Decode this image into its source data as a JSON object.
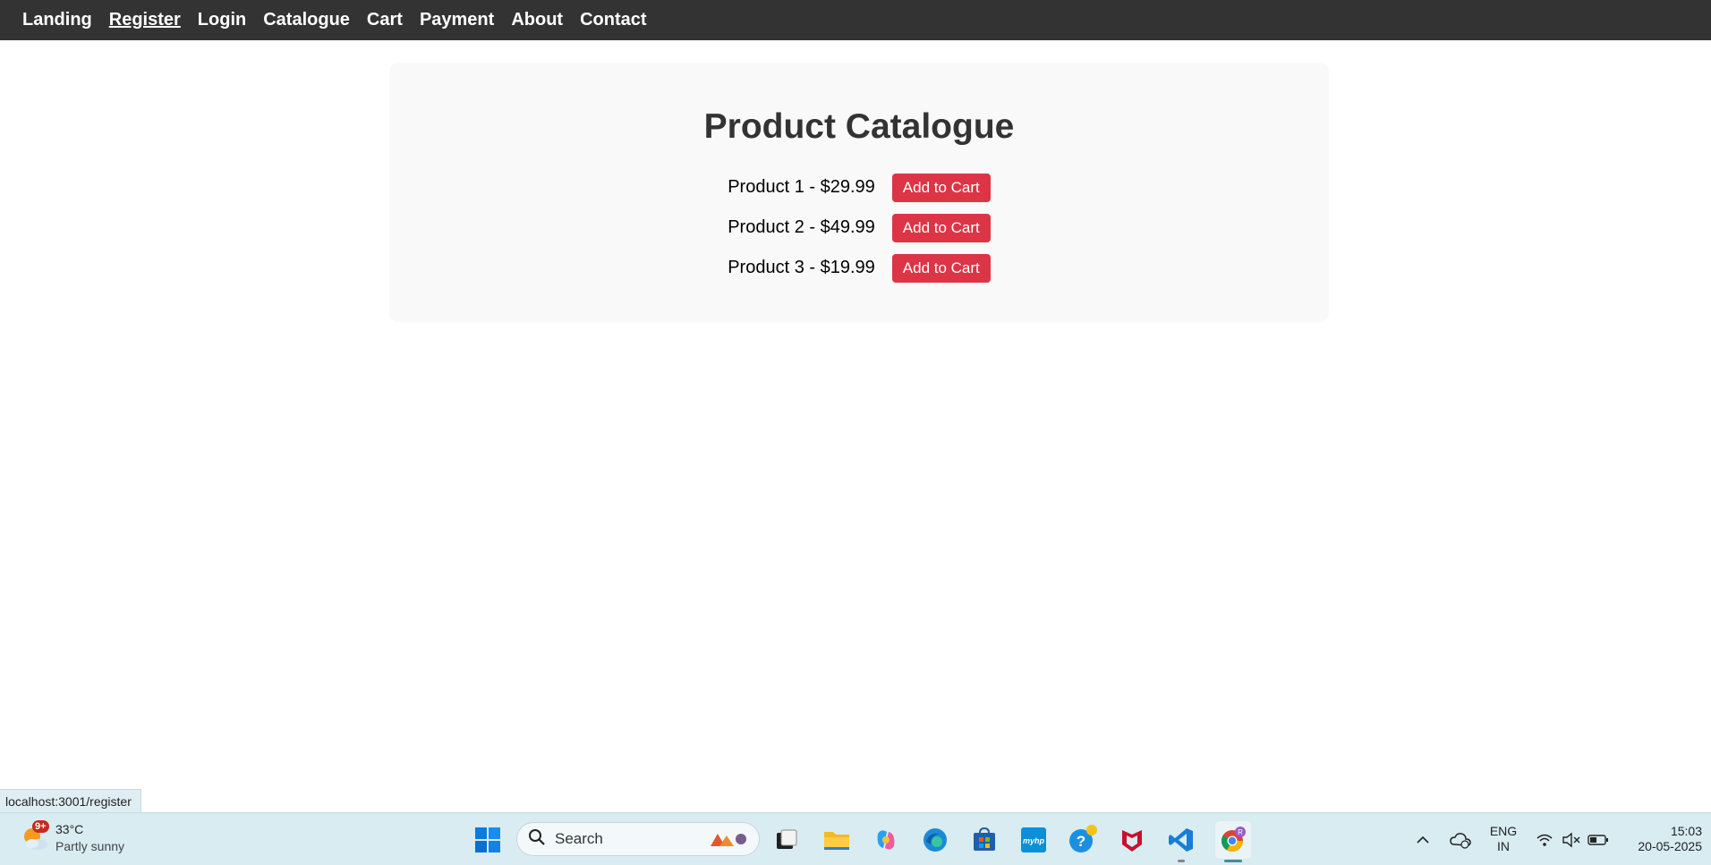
{
  "nav": {
    "items": [
      {
        "label": "Landing"
      },
      {
        "label": "Register"
      },
      {
        "label": "Login"
      },
      {
        "label": "Catalogue"
      },
      {
        "label": "Cart"
      },
      {
        "label": "Payment"
      },
      {
        "label": "About"
      },
      {
        "label": "Contact"
      }
    ],
    "hovered": "Register"
  },
  "catalogue": {
    "title": "Product Catalogue",
    "products": [
      {
        "label": "Product 1 - $29.99",
        "button": "Add to Cart"
      },
      {
        "label": "Product 2 - $49.99",
        "button": "Add to Cart"
      },
      {
        "label": "Product 3 - $19.99",
        "button": "Add to Cart"
      }
    ]
  },
  "status_bar": {
    "url": "localhost:3001/register"
  },
  "taskbar": {
    "weather": {
      "badge": "9+",
      "temperature": "33°C",
      "condition": "Partly sunny",
      "icon": "partly-sunny-icon"
    },
    "search": {
      "placeholder": "Search"
    },
    "pinned_apps": [
      {
        "name": "windows-start-icon"
      },
      {
        "name": "task-view-icon"
      },
      {
        "name": "file-explorer-icon"
      },
      {
        "name": "copilot-icon"
      },
      {
        "name": "edge-icon"
      },
      {
        "name": "store-icon"
      },
      {
        "name": "myhp-icon"
      },
      {
        "name": "get-help-icon"
      },
      {
        "name": "mcafee-icon"
      },
      {
        "name": "vscode-icon"
      },
      {
        "name": "chrome-icon"
      }
    ],
    "myhp_text": "myhp",
    "chrome_profile": "R",
    "tray": {
      "language": "ENG",
      "region": "IN",
      "time": "15:03",
      "date": "20-05-2025"
    }
  },
  "colors": {
    "nav_bg": "#333333",
    "button_red": "#dc3545",
    "card_bg": "#f9f9f9",
    "taskbar_bg": "#d8ecf2"
  }
}
